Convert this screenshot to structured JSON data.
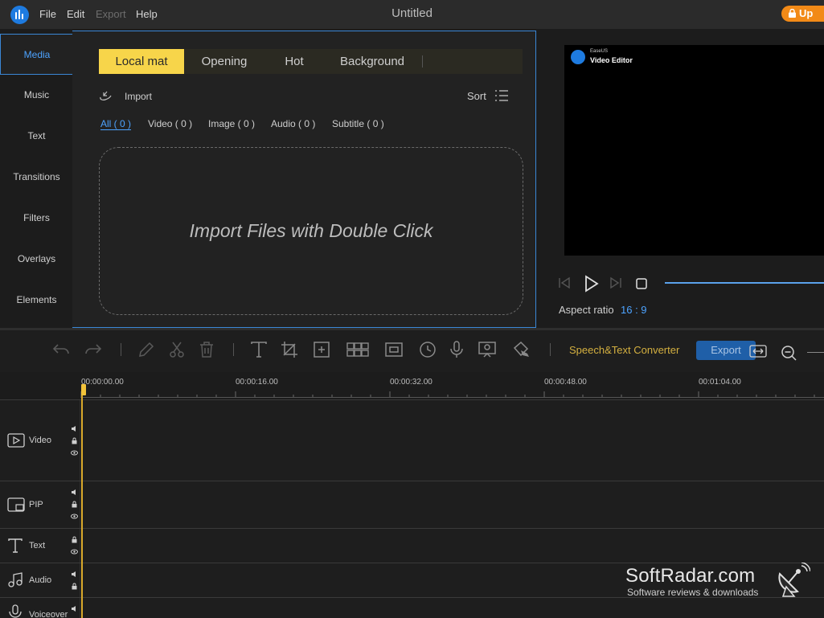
{
  "titlebar": {
    "menus": [
      "File",
      "Edit",
      "Export",
      "Help"
    ],
    "title": "Untitled",
    "upgrade_label": "Up"
  },
  "side_nav": {
    "items": [
      "Media",
      "Music",
      "Text",
      "Transitions",
      "Filters",
      "Overlays",
      "Elements"
    ],
    "active": "Media"
  },
  "media": {
    "tabs": [
      "Local mat",
      "Opening",
      "Hot",
      "Background"
    ],
    "active_tab": "Local mat",
    "import_label": "Import",
    "sort_label": "Sort",
    "filters": [
      "All ( 0 )",
      "Video ( 0 )",
      "Image ( 0 )",
      "Audio ( 0 )",
      "Subtitle ( 0 )"
    ],
    "dropzone_text": "Import Files with Double Click"
  },
  "preview": {
    "brand_small": "EaseUS",
    "brand": "Video Editor",
    "aspect_label": "Aspect ratio",
    "aspect_value": "16 : 9"
  },
  "toolbar": {
    "speech_label": "Speech&Text Converter",
    "export_label": "Export"
  },
  "timeline": {
    "ticks": [
      "00:00:00.00",
      "00:00:16.00",
      "00:00:32.00",
      "00:00:48.00",
      "00:01:04.00"
    ],
    "tracks": [
      "Video",
      "PIP",
      "Text",
      "Audio",
      "Voiceover"
    ]
  },
  "watermark": {
    "name": "SoftRadar.com",
    "tagline": "Software reviews & downloads"
  },
  "colors": {
    "accent_blue": "#3a87d6",
    "tab_active": "#f7d54a",
    "upgrade": "#f28a17",
    "playhead": "#f2c33a"
  }
}
